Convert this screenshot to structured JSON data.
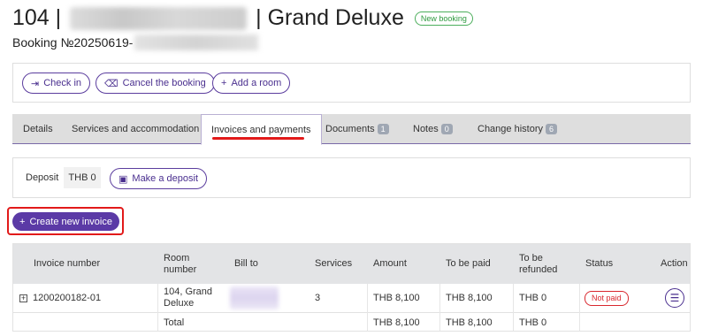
{
  "header": {
    "room_number": "104 |",
    "separator": "| Grand Deluxe",
    "new_badge": "New booking",
    "booking_label": "Booking №20250619-"
  },
  "actions": {
    "check_in": "Check in",
    "cancel": "Cancel the booking",
    "add_room": "Add a room"
  },
  "tabs": [
    {
      "label": "Details"
    },
    {
      "label": "Services and accommodation"
    },
    {
      "label": "Invoices and payments"
    },
    {
      "label": "Documents",
      "count": "1"
    },
    {
      "label": "Notes",
      "count": "0"
    },
    {
      "label": "Change history",
      "count": "6"
    }
  ],
  "deposit": {
    "label": "Deposit",
    "value": "THB 0",
    "make_deposit": "Make a deposit"
  },
  "create_invoice": "Create new invoice",
  "table": {
    "headers": [
      "Invoice number",
      "Room number",
      "Bill to",
      "Services",
      "Amount",
      "To be paid",
      "To be refunded",
      "Status",
      "Action"
    ],
    "rows": [
      {
        "invoice_number": "1200200182-01",
        "room_number": "104, Grand Deluxe",
        "services": "3",
        "amount": "THB 8,100",
        "to_be_paid": "THB 8,100",
        "to_be_refunded": "THB 0",
        "status": "Not paid"
      }
    ],
    "total": {
      "label": "Total",
      "amount": "THB 8,100",
      "to_be_paid": "THB 8,100",
      "to_be_refunded": "THB 0"
    }
  },
  "colors": {
    "accent": "#5b3aa6",
    "highlight": "#e21a1a",
    "badge_green": "#2e9a3f",
    "not_paid": "#d9272e"
  }
}
